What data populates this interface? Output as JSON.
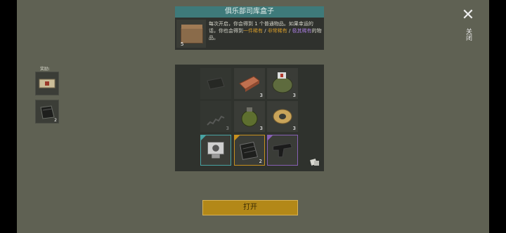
{
  "header": {
    "title": "俱乐部司库盒子",
    "quantity": "5",
    "description_1": "每次开启，你会得到 1 个普通物品。如果幸运的话，你也会得到",
    "rare": "一件稀有",
    "sep1": " / ",
    "very_rare": "非常稀有",
    "sep2": " / ",
    "extreme_rare": "极其稀有",
    "description_2": "的物品。"
  },
  "close": {
    "label": "关闭"
  },
  "rewards": {
    "label": "奖励:",
    "items": [
      {
        "icon": "bandage-icon",
        "qty": ""
      },
      {
        "icon": "metal-plate-icon",
        "qty": "2"
      }
    ]
  },
  "grid": {
    "cells": [
      {
        "icon": "dark-plate-icon",
        "qty": "",
        "dim": true
      },
      {
        "icon": "copper-ingot-icon",
        "qty": "3"
      },
      {
        "icon": "medical-bag-icon",
        "qty": "3"
      },
      {
        "icon": "spring-icon",
        "qty": "3",
        "dim": true
      },
      {
        "icon": "grenade-icon",
        "qty": "3"
      },
      {
        "icon": "wire-spool-icon",
        "qty": "3"
      },
      {
        "icon": "engine-part-icon",
        "qty": "",
        "rarity": "teal"
      },
      {
        "icon": "metal-plate-icon",
        "qty": "2",
        "rarity": "orange"
      },
      {
        "icon": "smg-icon",
        "qty": "",
        "rarity": "purple"
      }
    ]
  },
  "open_button": {
    "label": "打开"
  },
  "colors": {
    "teal": "#49a3a3",
    "orange": "#c7901f",
    "purple": "#8660b3",
    "button": "#b38818"
  }
}
